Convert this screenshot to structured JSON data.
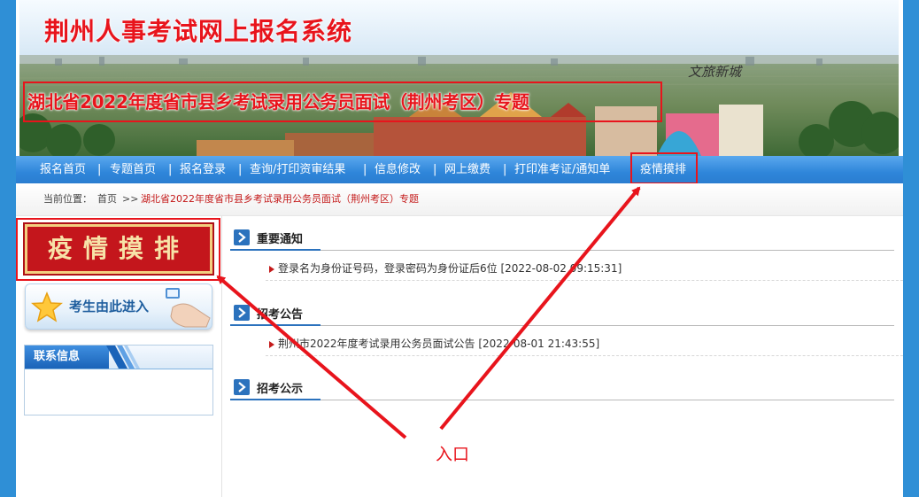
{
  "banner": {
    "title": "荆州人事考试网上报名系统",
    "slogan": "文旅新城",
    "subject": "湖北省2022年度省市县乡考试录用公务员面试（荆州考区）专题"
  },
  "nav": {
    "items": [
      {
        "label": "报名首页"
      },
      {
        "label": "专题首页"
      },
      {
        "label": "报名登录"
      },
      {
        "label": "查询/打印资审结果"
      },
      {
        "label": "信息修改"
      },
      {
        "label": "网上缴费"
      },
      {
        "label": "打印准考证/通知单"
      },
      {
        "label": "疫情摸排"
      }
    ],
    "separator": "|"
  },
  "breadcrumb": {
    "prefix": "当前位置：",
    "home": "首页",
    "arrow": ">>",
    "current": "湖北省2022年度省市县乡考试录用公务员面试（荆州考区）专题"
  },
  "sidebar": {
    "epidemic_button": "疫情摸排",
    "entry_button": "考生由此进入",
    "contact_title": "联系信息"
  },
  "sections": [
    {
      "title": "重要通知",
      "items": [
        "登录名为身份证号码，登录密码为身份证后6位 [2022-08-02 09:15:31]"
      ]
    },
    {
      "title": "招考公告",
      "items": [
        "荆州市2022年度考试录用公务员面试公告 [2022-08-01 21:43:55]"
      ]
    },
    {
      "title": "招考公示",
      "items": []
    }
  ],
  "annotation": {
    "label": "入口"
  },
  "colors": {
    "accent_red": "#e8141c",
    "nav_blue": "#2f86da",
    "frame_blue": "#2f8fd6"
  }
}
